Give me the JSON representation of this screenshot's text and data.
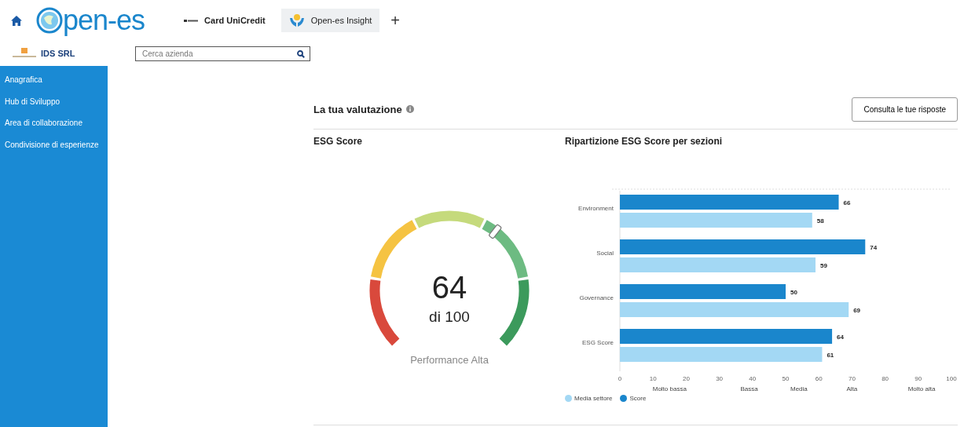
{
  "header": {
    "logo_text": "pen-es",
    "tabs": [
      {
        "label": "Card UniCredit",
        "selected": false
      },
      {
        "label": "Open-es Insight",
        "selected": true
      }
    ],
    "add_tab": "+"
  },
  "company": {
    "name": "IDS SRL"
  },
  "search": {
    "placeholder": "Cerca azienda"
  },
  "sidebar": {
    "items": [
      {
        "label": "Anagrafica"
      },
      {
        "label": "Hub di Sviluppo"
      },
      {
        "label": "Area di collaborazione"
      },
      {
        "label": "Condivisione di esperienze"
      }
    ]
  },
  "evaluation": {
    "title": "La tua valutazione",
    "button": "Consulta le tue risposte"
  },
  "gauge": {
    "title": "ESG Score",
    "value": "64",
    "of": "di 100",
    "caption": "Performance Alta"
  },
  "breakdown": {
    "title": "Ripartizione ESG Score per sezioni",
    "chart_data": {
      "type": "bar",
      "orientation": "horizontal",
      "categories": [
        "Environment",
        "Social",
        "Governance",
        "ESG Score"
      ],
      "series": [
        {
          "name": "Score",
          "color": "#1a86cc",
          "values": [
            66,
            74,
            50,
            64
          ]
        },
        {
          "name": "Media settore",
          "color": "#a3d8f4",
          "values": [
            58,
            59,
            69,
            61
          ]
        }
      ],
      "xlim": [
        0,
        100
      ],
      "xticks": [
        0,
        10,
        20,
        30,
        40,
        50,
        60,
        70,
        80,
        90,
        100
      ],
      "data_labels": true
    },
    "bands": [
      "Molto bassa",
      "Bassa",
      "Media",
      "Alta",
      "Molto alta"
    ]
  }
}
